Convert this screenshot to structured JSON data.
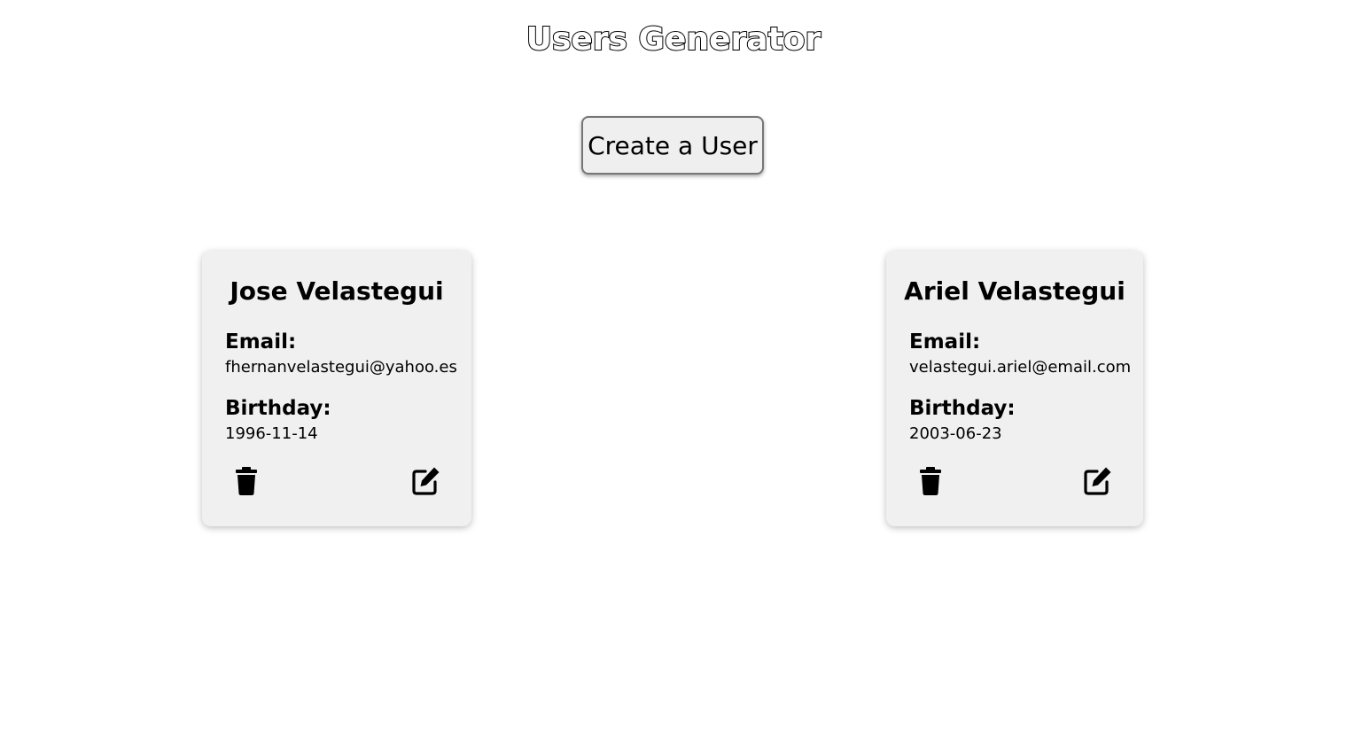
{
  "header": {
    "title": "Users Generator"
  },
  "actions": {
    "create_label": "Create a User"
  },
  "users": [
    {
      "name": "Jose Velastegui",
      "email_label": "Email:",
      "email": "fhernanvelastegui@yahoo.es",
      "birthday_label": "Birthday:",
      "birthday": "1996-11-14",
      "delete_icon": "trash-icon",
      "edit_icon": "edit-icon"
    },
    {
      "name": "Ariel Velastegui",
      "email_label": "Email:",
      "email": "velastegui.ariel@email.com",
      "birthday_label": "Birthday:",
      "birthday": "2003-06-23",
      "delete_icon": "trash-icon",
      "edit_icon": "edit-icon"
    }
  ],
  "colors": {
    "card_background": "#f0f0f0",
    "button_background": "#efefef",
    "text": "#000000"
  }
}
